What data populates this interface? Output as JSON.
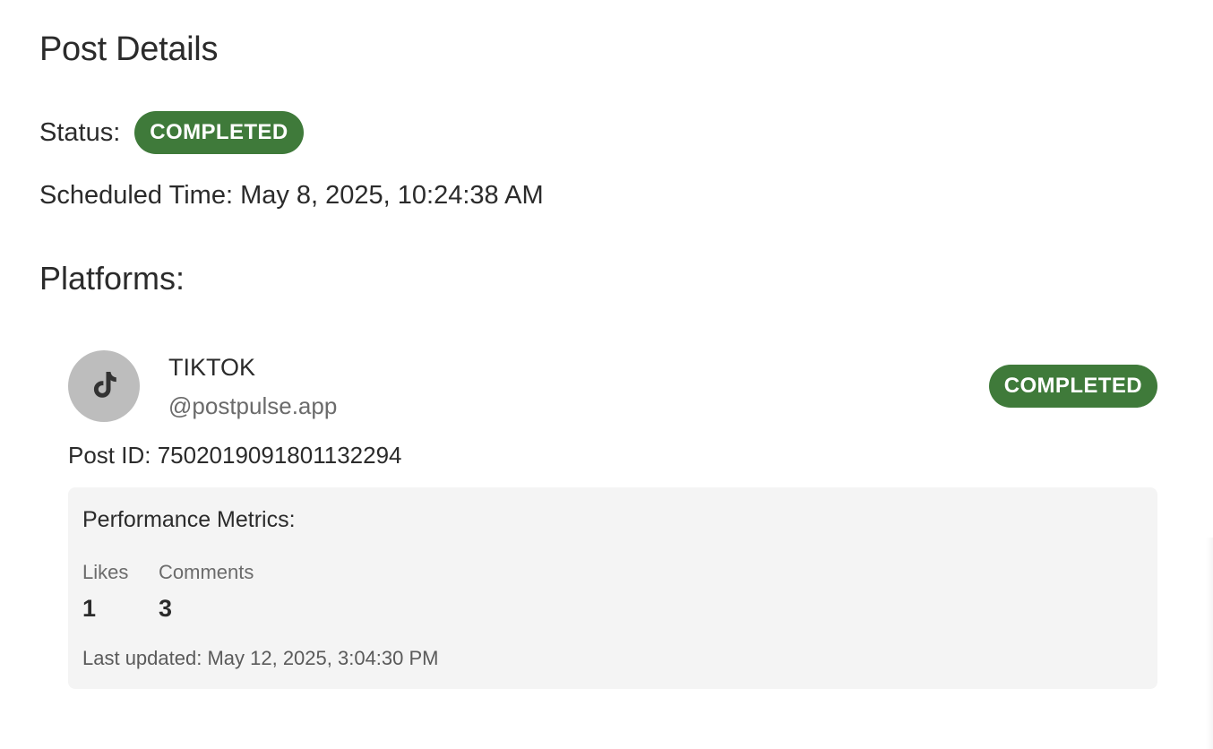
{
  "page": {
    "title": "Post Details",
    "status_label": "Status:",
    "status_value": "COMPLETED",
    "scheduled_time": "Scheduled Time: May 8, 2025, 10:24:38 AM",
    "platforms_heading": "Platforms:"
  },
  "platforms": [
    {
      "icon": "tiktok-icon",
      "name": "TIKTOK",
      "handle": "@postpulse.app",
      "status": "COMPLETED",
      "post_id": "Post ID: 7502019091801132294",
      "metrics": {
        "title": "Performance Metrics:",
        "likes_label": "Likes",
        "likes_value": "1",
        "comments_label": "Comments",
        "comments_value": "3",
        "last_updated": "Last updated: May 12, 2025, 3:04:30 PM"
      }
    }
  ],
  "colors": {
    "badge_bg": "#3f7a3a",
    "badge_text": "#ffffff",
    "avatar_bg": "#bdbdbd",
    "metrics_bg": "#f4f4f4"
  }
}
